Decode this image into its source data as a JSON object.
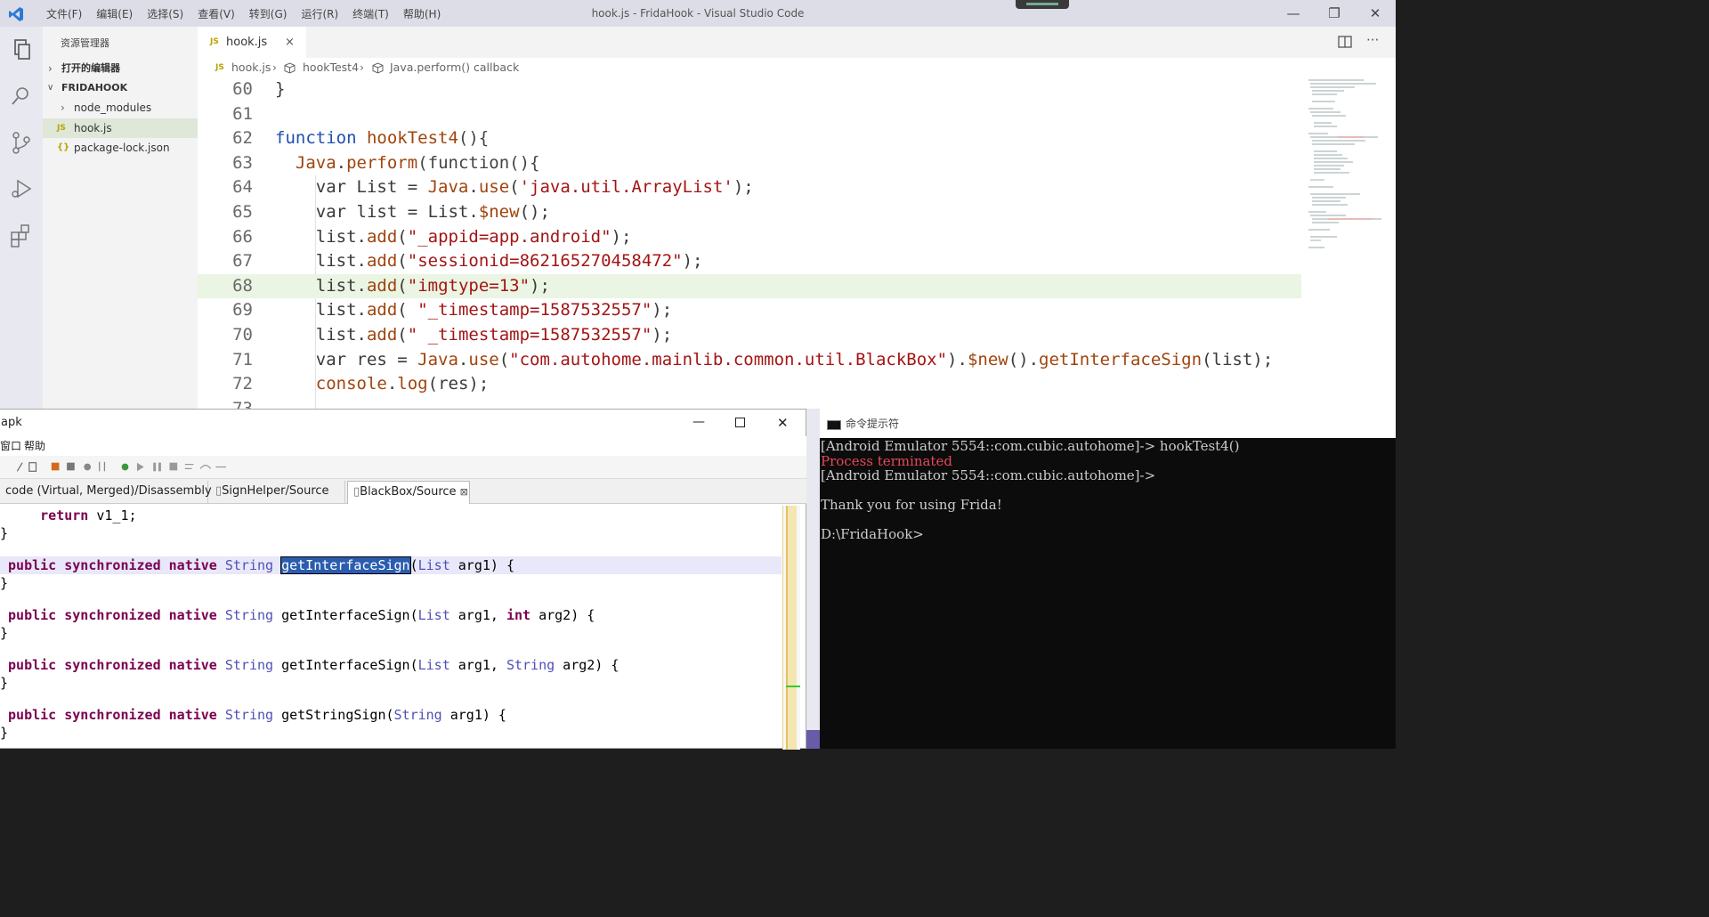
{
  "titlebar": {
    "menu": [
      "文件(F)",
      "编辑(E)",
      "选择(S)",
      "查看(V)",
      "转到(G)",
      "运行(R)",
      "终端(T)",
      "帮助(H)"
    ],
    "title": "hook.js - FridaHook - Visual Studio Code"
  },
  "sidebar": {
    "header": "资源管理器",
    "open_editors": "打开的编辑器",
    "project": "FRIDAHOOK",
    "items": [
      {
        "icon": "›",
        "label": "node_modules"
      },
      {
        "icon": "JS",
        "label": "hook.js"
      },
      {
        "icon": "{}",
        "label": "package-lock.json"
      }
    ]
  },
  "editor": {
    "tab": {
      "icon": "JS",
      "label": "hook.js",
      "close": "×"
    },
    "breadcrumb": {
      "icon": "JS",
      "parts": [
        "hook.js",
        "hookTest4",
        "Java.perform() callback"
      ],
      "sep": "›"
    },
    "line_numbers": [
      "60",
      "61",
      "62",
      "63",
      "64",
      "65",
      "66",
      "67",
      "68",
      "69",
      "70",
      "71",
      "72",
      "73"
    ],
    "code": {
      "l60": "}",
      "l62_kw": "function",
      "l62_fn": "hookTest4",
      "l62_rest": "(){",
      "l63_obj": "Java",
      "l63_fn": "perform",
      "l63_rest": "(function(){",
      "l64": [
        "var List = ",
        "Java",
        ".",
        "use",
        "(",
        "'java.util.ArrayList'",
        ");"
      ],
      "l65": [
        "var list = List.",
        "$new",
        "();"
      ],
      "l66": [
        "list.",
        "add",
        "(",
        "\"_appid=app.android\"",
        ");"
      ],
      "l67": [
        "list.",
        "add",
        "(",
        "\"sessionid=862165270458472\"",
        ");"
      ],
      "l68": [
        "list.",
        "add",
        "(",
        "\"imgtype=13\"",
        ");"
      ],
      "l69": [
        "list.",
        "add",
        "( ",
        "\"_timestamp=1587532557\"",
        ");"
      ],
      "l70": [
        "list.",
        "add",
        "(",
        "\" _timestamp=1587532557\"",
        ");"
      ],
      "l71": [
        "var res = ",
        "Java",
        ".",
        "use",
        "(",
        "\"com.autohome.mainlib.common.util.BlackBox\"",
        ").",
        "$new",
        "().",
        "getInterfaceSign",
        "(list);"
      ],
      "l72": [
        "console",
        ".",
        "log",
        "(res);"
      ]
    }
  },
  "jeb": {
    "title": "apk",
    "menu": [
      "窗口",
      "帮助"
    ],
    "tabs": [
      {
        "label": "code (Virtual, Merged)/Disassembly"
      },
      {
        "label": "SignHelper/Source"
      },
      {
        "label": "BlackBox/Source",
        "close": "⊠"
      }
    ],
    "lines": {
      "ret": "    return v1_1;",
      "brace": "}",
      "kw": "public synchronized native ",
      "ty_string": "String",
      "ty_list": "List",
      "kw_int": "int",
      "m_sign": "getInterfaceSign",
      "m_string_sign": "getStringSign",
      "p_arg1": " arg1) {",
      "p_arg1c": " arg1, ",
      "p_arg2": " arg2) {"
    }
  },
  "cmd": {
    "title": "命令提示符",
    "lines": [
      "[Android Emulator 5554::com.cubic.autohome]-> hookTest4()",
      "Process terminated",
      "[Android Emulator 5554::com.cubic.autohome]->",
      "",
      "Thank you for using Frida!",
      "",
      "D:\\FridaHook>"
    ],
    "error_color": "#e74856"
  }
}
